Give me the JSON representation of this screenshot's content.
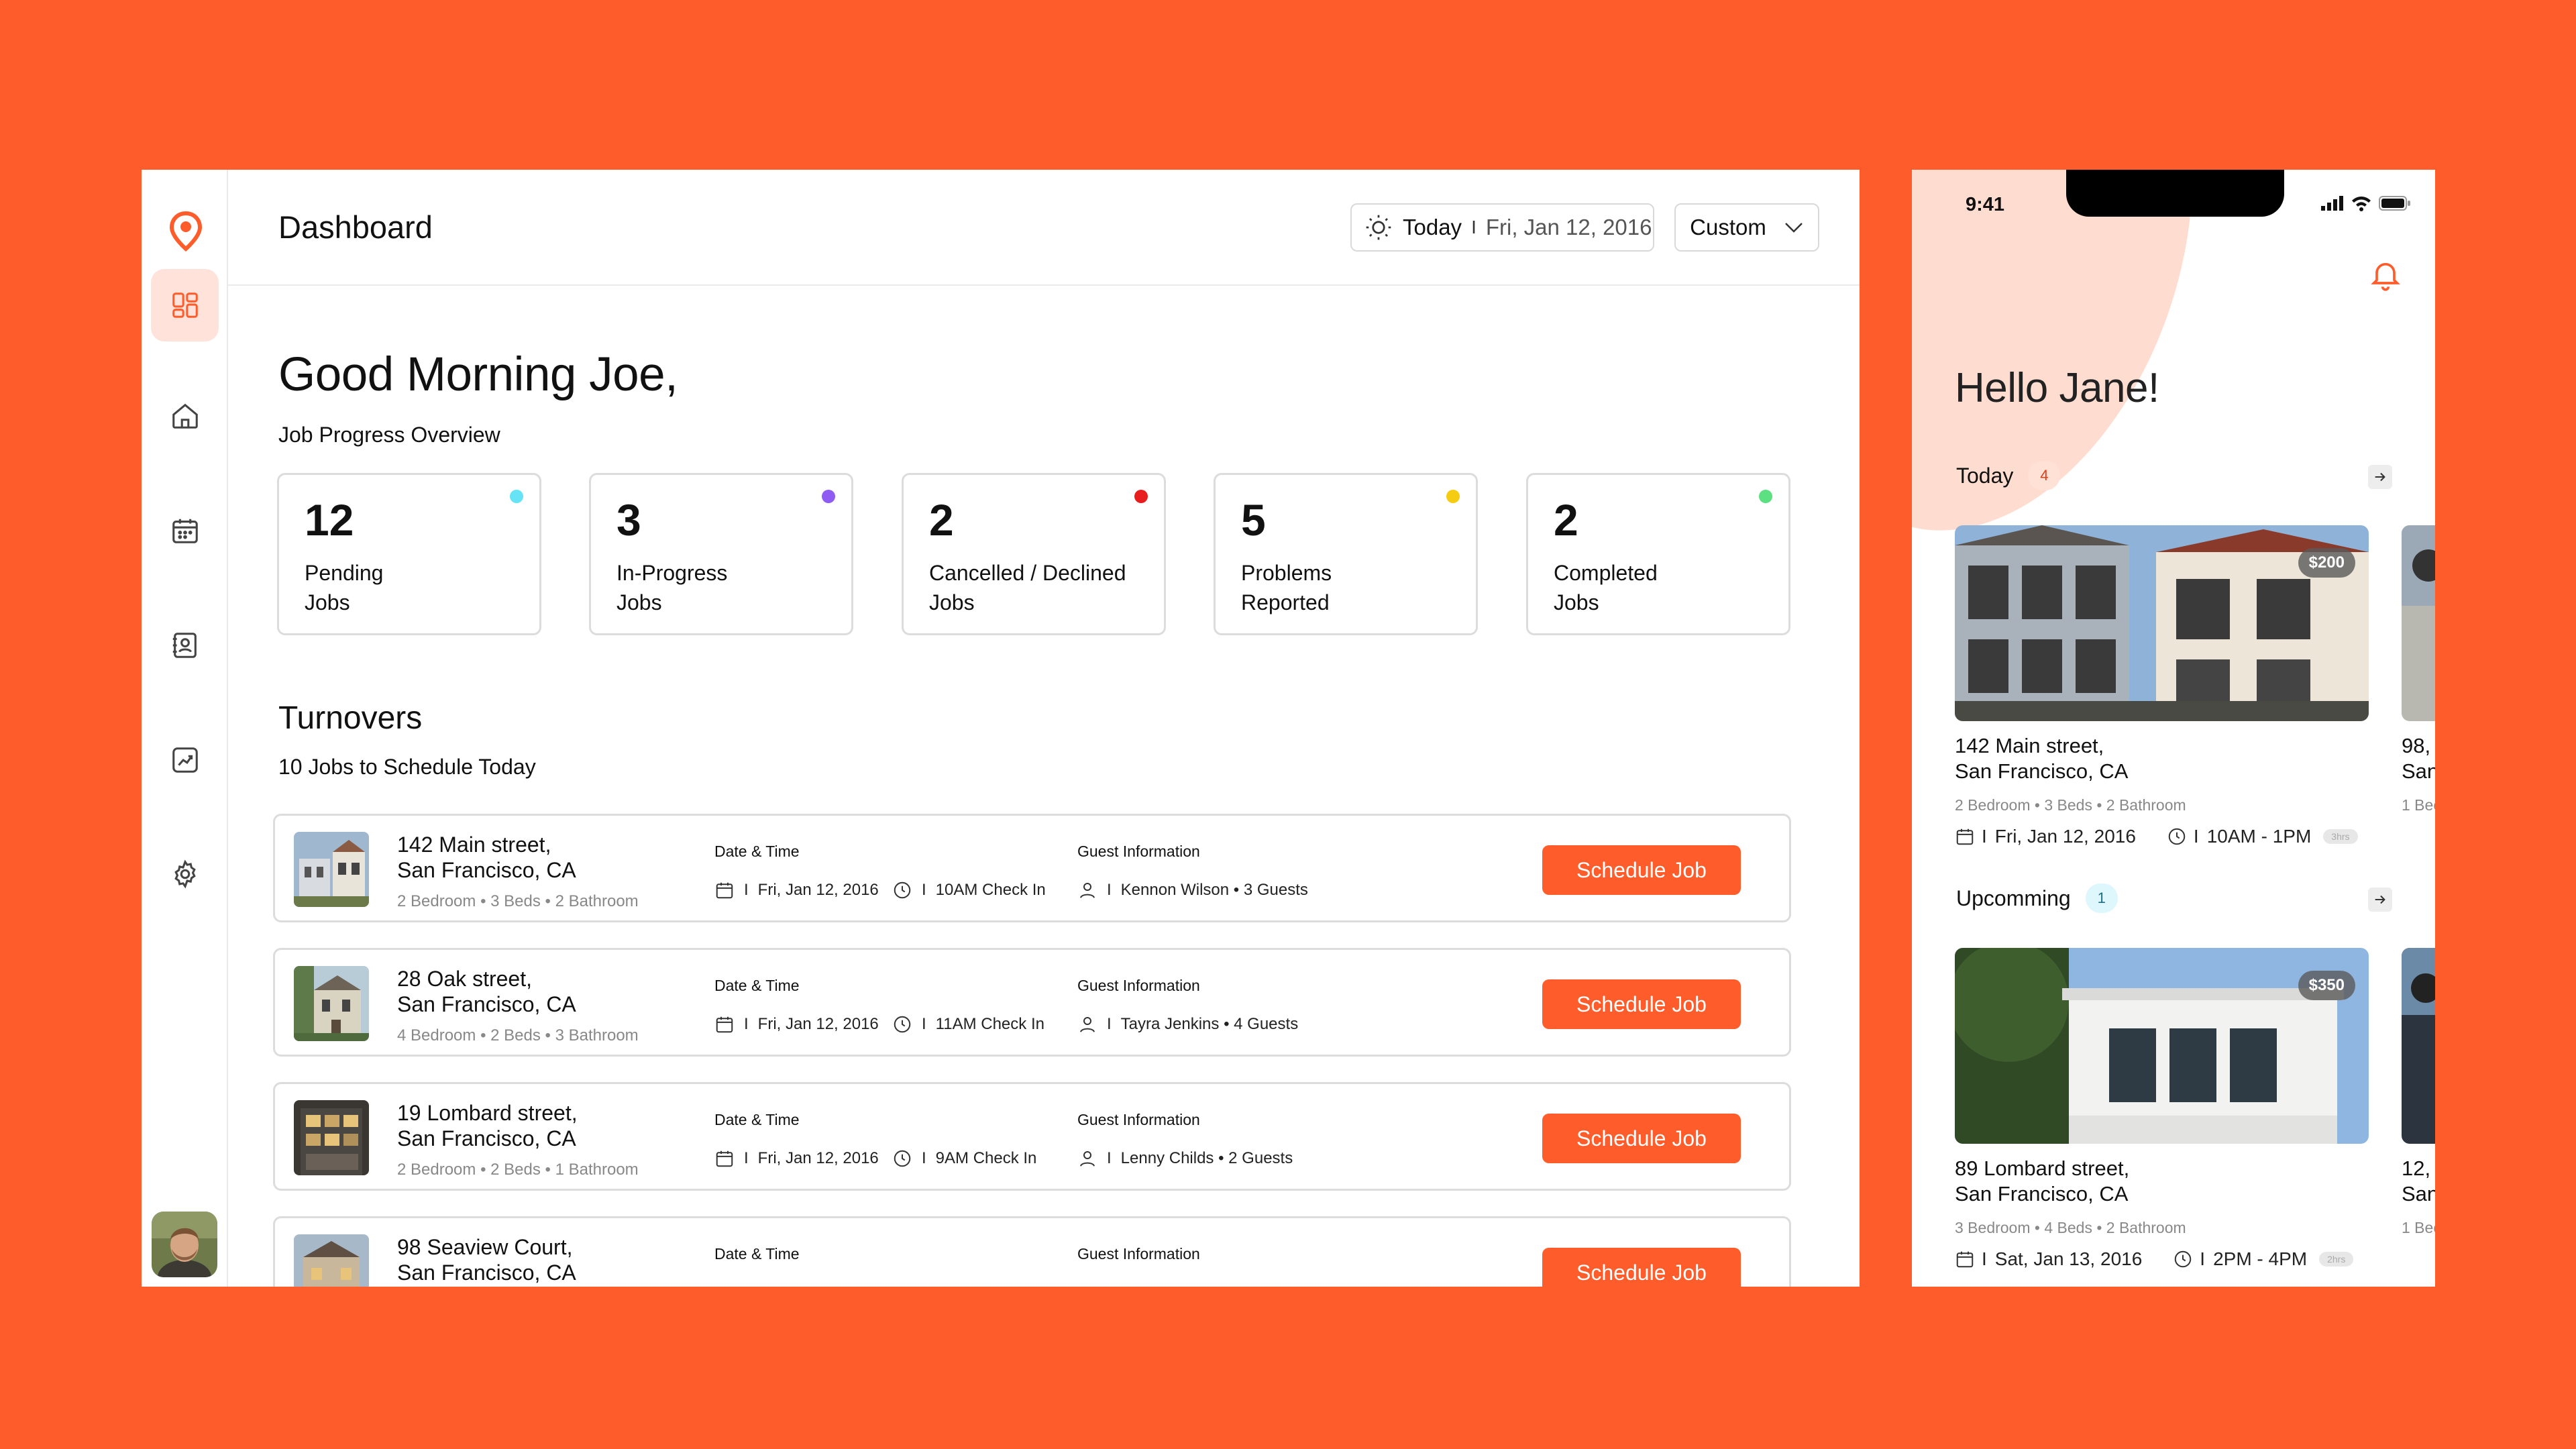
{
  "desktop": {
    "title": "Dashboard",
    "date_today": "Today",
    "date_sep": "I",
    "date_value": "Fri, Jan 12, 2016",
    "custom_label": "Custom",
    "greeting": "Good Morning Joe,",
    "overview_label": "Job Progress Overview",
    "stats": [
      {
        "num": "12",
        "label": "Pending\nJobs",
        "color": "#66E3F5"
      },
      {
        "num": "3",
        "label": "In-Progress\nJobs",
        "color": "#8E5BF3"
      },
      {
        "num": "2",
        "label": "Cancelled / Declined\nJobs",
        "color": "#E81E1E"
      },
      {
        "num": "5",
        "label": "Problems\nReported",
        "color": "#F5CC12"
      },
      {
        "num": "2",
        "label": "Completed\nJobs",
        "color": "#5CE082"
      }
    ],
    "turnovers_title": "Turnovers",
    "turnovers_sub": "10 Jobs to Schedule Today",
    "date_time_head": "Date & Time",
    "guest_head": "Guest Information",
    "schedule_label": "Schedule Job",
    "jobs": [
      {
        "addr1": "142 Main street,",
        "addr2": "San Francisco, CA",
        "meta": "2 Bedroom • 3 Beds • 2 Bathroom",
        "date": "Fri, Jan 12, 2016",
        "time": "10AM Check In",
        "guest": "Kennon Wilson • 3 Guests"
      },
      {
        "addr1": "28 Oak street,",
        "addr2": "San Francisco, CA",
        "meta": "4 Bedroom • 2 Beds • 3 Bathroom",
        "date": "Fri, Jan 12, 2016",
        "time": "11AM Check In",
        "guest": "Tayra Jenkins • 4 Guests"
      },
      {
        "addr1": "19 Lombard street,",
        "addr2": "San Francisco, CA",
        "meta": "2 Bedroom • 2 Beds • 1 Bathroom",
        "date": "Fri, Jan 12, 2016",
        "time": "9AM Check In",
        "guest": "Lenny Childs • 2 Guests"
      },
      {
        "addr1": "98 Seaview Court,",
        "addr2": "San Francisco, CA",
        "meta": "",
        "date": "",
        "time": "",
        "guest": ""
      }
    ],
    "bar": "I"
  },
  "mobile": {
    "time": "9:41",
    "hello": "Hello Jane!",
    "today_label": "Today",
    "today_count": "4",
    "upcoming_label": "Upcomming",
    "upcoming_count": "1",
    "today_card": {
      "price": "$200",
      "addr1": "142 Main street,",
      "addr2": "San Francisco, CA",
      "meta": "2 Bedroom • 3 Beds • 2 Bathroom",
      "date": "Fri, Jan 12, 2016",
      "time": "10AM - 1PM",
      "dur": "3hrs"
    },
    "today_card_peek": {
      "addr1": "98,",
      "addr2": "San",
      "meta": "1 Bec"
    },
    "upcoming_card": {
      "price": "$350",
      "addr1": "89 Lombard street,",
      "addr2": "San Francisco, CA",
      "meta": "3 Bedroom • 4 Beds • 2 Bathroom",
      "date": "Sat, Jan 13, 2016",
      "time": "2PM - 4PM",
      "dur": "2hrs"
    },
    "upcoming_card_peek": {
      "addr1": "12,",
      "addr2": "San",
      "meta": "1 Bec"
    },
    "bar": "I"
  },
  "colors": {
    "accent": "#FF5C2B",
    "accent_light": "#FFE3DA"
  }
}
